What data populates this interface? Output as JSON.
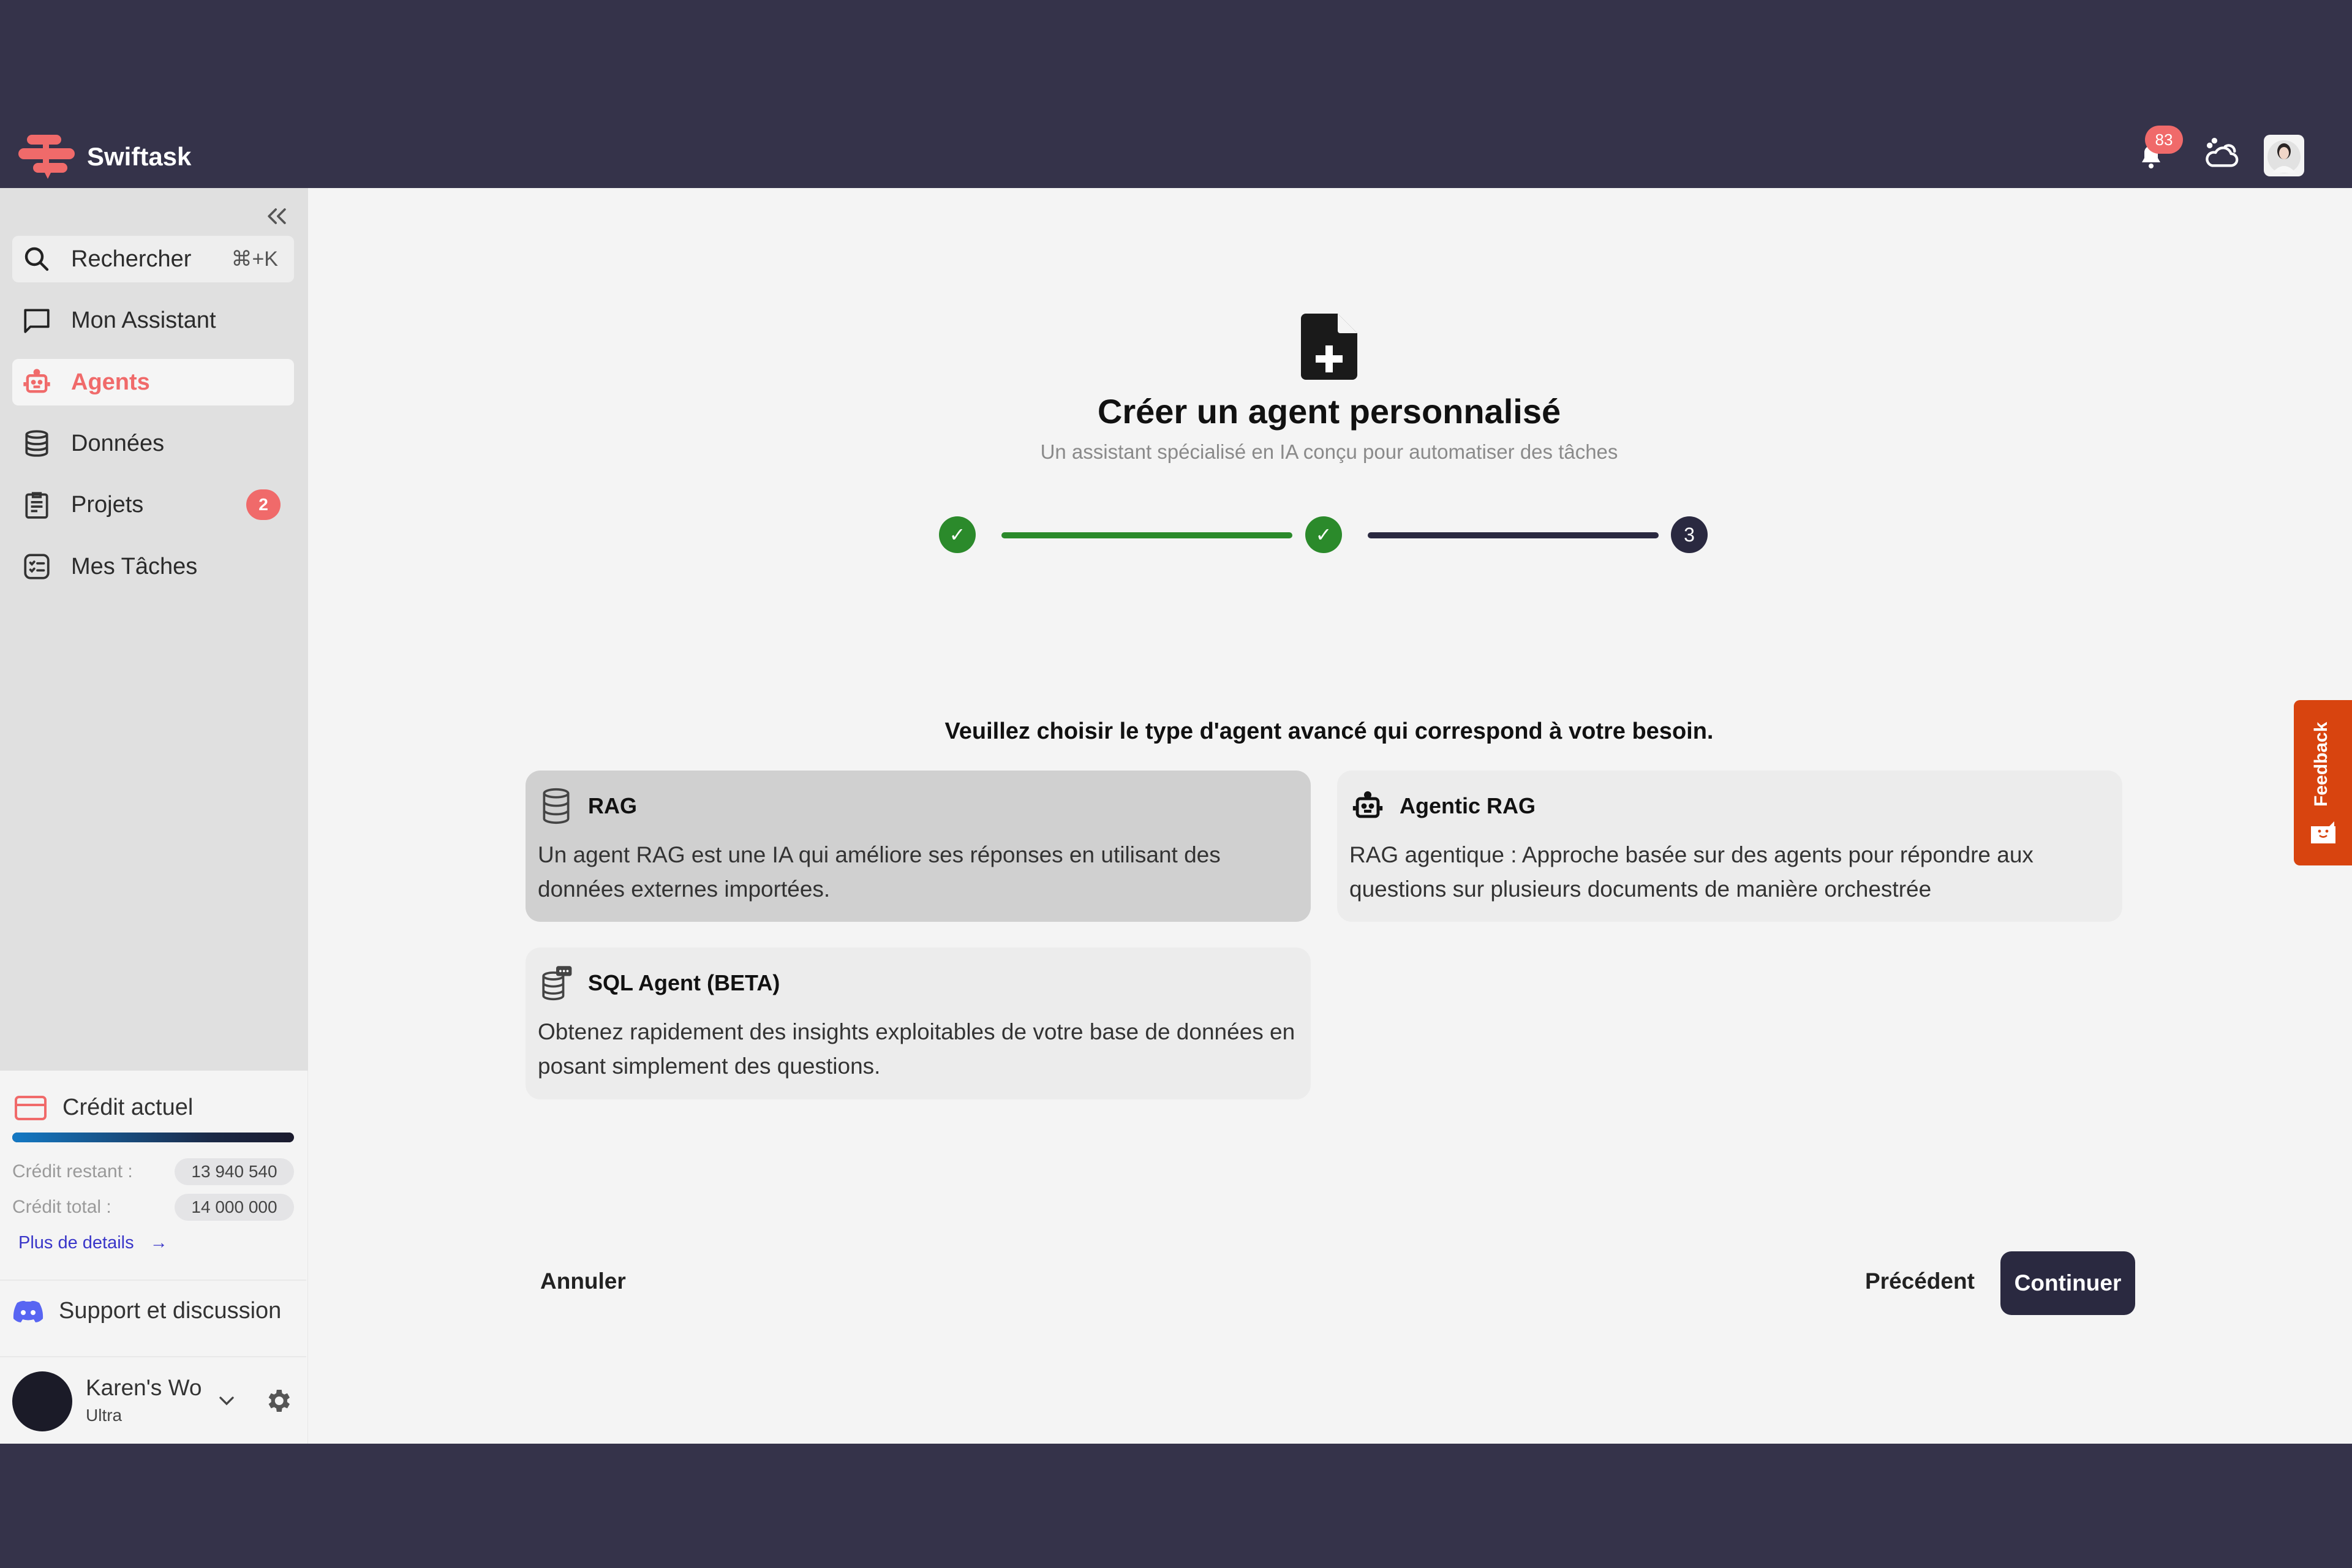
{
  "header": {
    "brand": "Swiftask",
    "notification_count": "83",
    "brand_color": "#f06a6a",
    "dark_color": "#35334a"
  },
  "sidebar": {
    "search": {
      "label": "Rechercher",
      "shortcut": "⌘+K"
    },
    "items": [
      {
        "label": "Mon Assistant",
        "icon": "chat-icon"
      },
      {
        "label": "Agents",
        "icon": "robot-icon",
        "active": true
      },
      {
        "label": "Données",
        "icon": "database-icon"
      },
      {
        "label": "Projets",
        "icon": "clipboard-icon",
        "badge": "2"
      },
      {
        "label": "Mes Tâches",
        "icon": "tasks-icon"
      }
    ],
    "credit": {
      "title": "Crédit actuel",
      "remaining_label": "Crédit restant :",
      "remaining_value": "13 940 540",
      "total_label": "Crédit total :",
      "total_value": "14 000 000",
      "remaining_fraction": 0.9957,
      "more_link": "Plus de details"
    },
    "support": "Support et discussion",
    "user": {
      "name": "Karen's Wo",
      "plan": "Ultra"
    }
  },
  "main": {
    "title": "Créer un agent personnalisé",
    "subtitle": "Un assistant spécialisé en IA conçu pour automatiser des tâches",
    "steps": [
      {
        "state": "done",
        "label": "✓"
      },
      {
        "state": "done",
        "label": "✓"
      },
      {
        "state": "current",
        "label": "3"
      }
    ],
    "question": "Veuillez choisir le type d'agent avancé qui correspond à votre besoin.",
    "cards": [
      {
        "title": "RAG",
        "description": "Un agent RAG est une IA qui améliore ses réponses en utilisant des données externes importées.",
        "selected": true
      },
      {
        "title": "Agentic RAG",
        "description": "RAG agentique : Approche basée sur des agents pour répondre aux questions sur plusieurs documents de manière orchestrée",
        "selected": false
      },
      {
        "title": "SQL Agent (BETA)",
        "description": "Obtenez rapidement des insights exploitables de votre base de données en posant simplement des questions.",
        "selected": false
      }
    ],
    "cancel_label": "Annuler",
    "prev_label": "Précédent",
    "continue_label": "Continuer",
    "step_done_color": "#2b8a2b",
    "step_current_color": "#2a2940"
  },
  "feedback": {
    "label": "Feedback",
    "color": "#d8440f"
  }
}
